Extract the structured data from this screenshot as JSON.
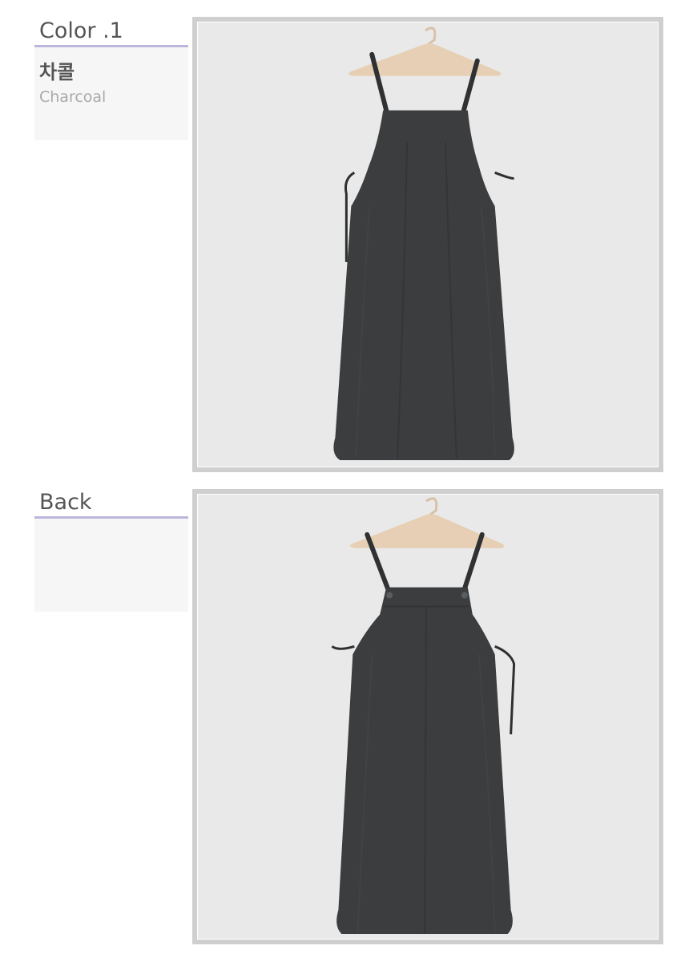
{
  "colors": {
    "heading_text": "#555555",
    "underline": "#bdb6dc",
    "info_bg": "#f6f6f6",
    "frame": "#cfcfcf",
    "wall": "#e9e9e9",
    "dress": "#3b3d3f",
    "hanger": "#e6cfb4"
  },
  "sections": [
    {
      "heading": "Color .1",
      "name_ko": "차콜",
      "name_en": "Charcoal",
      "photo_icon": "dress-front-photo"
    },
    {
      "heading": "Back",
      "name_ko": "",
      "name_en": "",
      "photo_icon": "dress-back-photo"
    }
  ]
}
